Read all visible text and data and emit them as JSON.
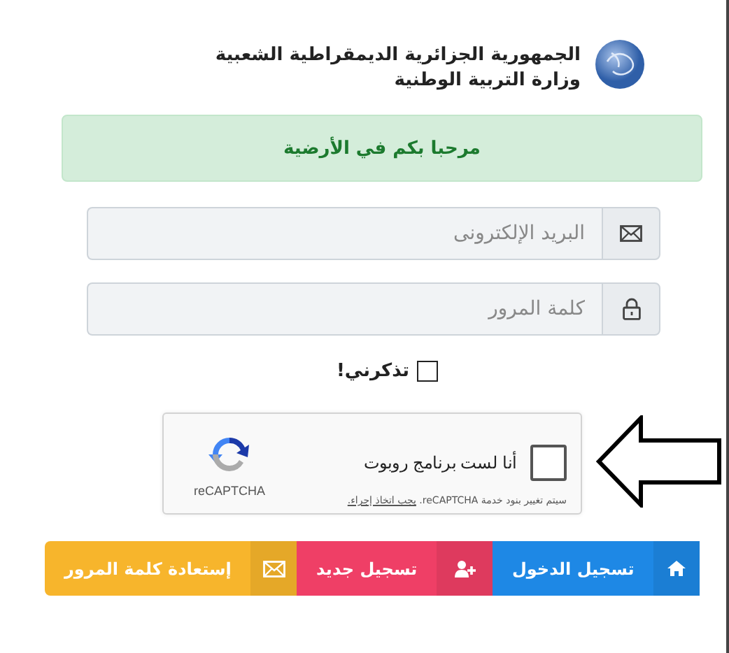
{
  "header": {
    "lines": [
      "الجمهورية الجزائرية الديمقراطية الشعبية",
      "وزارة التربية الوطنية"
    ]
  },
  "alert": {
    "text": "مرحبا بكم في الأرضية"
  },
  "fields": [
    {
      "kind": "email",
      "placeholder": "البريد الإلكترونى"
    },
    {
      "kind": "password",
      "placeholder": "كلمة المرور"
    }
  ],
  "remember": {
    "label": "تذكرني!",
    "checked": false
  },
  "captcha": {
    "label": "أنا لست برنامج روبوت",
    "checked": false,
    "brand": "reCAPTCHA",
    "terms": "سيتم تغيير بنود خدمة reCAPTCHA.",
    "terms_link": "يجب اتخاذ إجراء."
  },
  "buttons": [
    {
      "kind": "home",
      "label": "تسجيل الدخول",
      "color": "#1e88e5"
    },
    {
      "kind": "user-plus",
      "label": "تسجيل جديد",
      "color": "#ef3f66"
    },
    {
      "kind": "mail",
      "label": "إستعادة كلمة المرور",
      "color": "#f7b52c"
    }
  ]
}
